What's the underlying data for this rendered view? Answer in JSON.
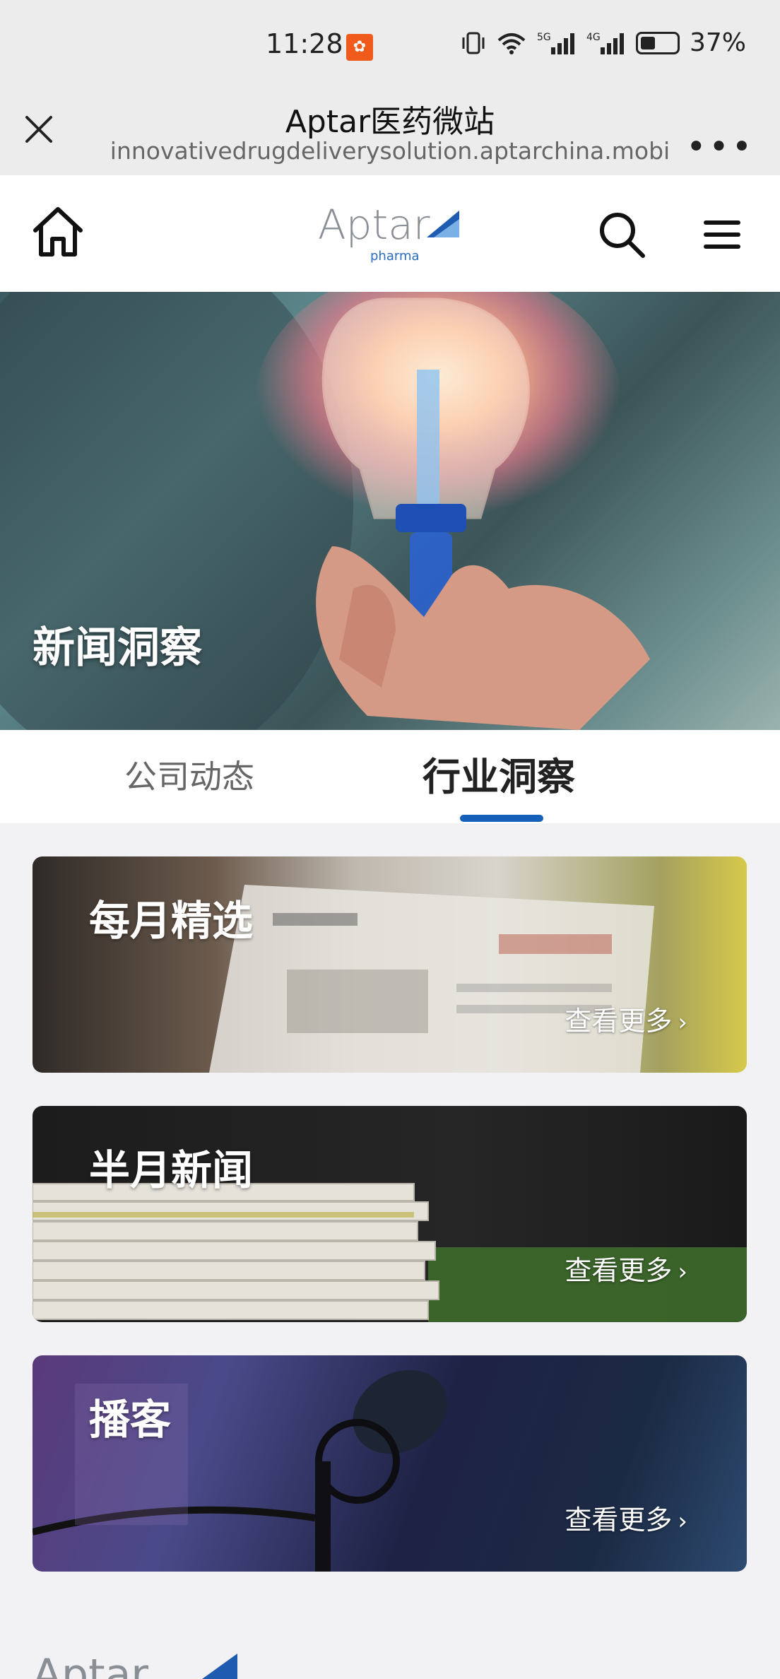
{
  "status_bar": {
    "time": "11:28",
    "network_5g": "5G",
    "network_4g": "4G",
    "battery": "37%"
  },
  "browser": {
    "title": "Aptar医药微站",
    "url": "innovativedrugdeliverysolution.aptarchina.mobi",
    "more": "•••"
  },
  "header": {
    "logo_word": "Aptar",
    "logo_sub": "pharma"
  },
  "hero": {
    "title": "新闻洞察"
  },
  "tabs": [
    {
      "label": "公司动态",
      "active": false
    },
    {
      "label": "行业洞察",
      "active": true
    }
  ],
  "cards": [
    {
      "title": "每月精选",
      "more": "查看更多"
    },
    {
      "title": "半月新闻",
      "more": "查看更多"
    },
    {
      "title": "播客",
      "more": "查看更多"
    }
  ],
  "colors": {
    "accent": "#1560b8",
    "status_badge": "#f05a1a"
  }
}
